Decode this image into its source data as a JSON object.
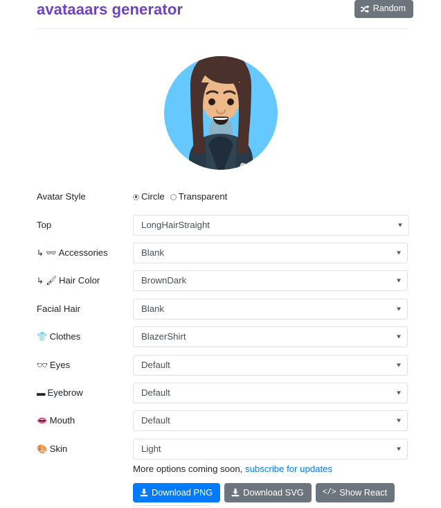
{
  "header": {
    "title": "avataaars generator",
    "random_button": {
      "label": "Random",
      "icon": "shuffle-icon",
      "bg": "#6c757d"
    },
    "title_color": "#6f42c1"
  },
  "avatar": {
    "style": "Circle",
    "background_color": "#65C9FF",
    "skin_color": "#EDB98A",
    "hair_color": "#4A312C",
    "clothes_color": "#25557C",
    "clothes_shade": "#3C4F5C"
  },
  "form": {
    "rows": [
      {
        "label": "Avatar Style",
        "icon": null,
        "nested": false,
        "control": "radio",
        "options": [
          {
            "label": "Circle",
            "checked": true
          },
          {
            "label": "Transparent",
            "checked": false
          }
        ]
      },
      {
        "label": "Top",
        "icon": null,
        "nested": false,
        "control": "select",
        "value": "LongHairStraight"
      },
      {
        "label": "Accessories",
        "icon": "glasses-icon",
        "nested": true,
        "control": "select",
        "value": "Blank"
      },
      {
        "label": "Hair Color",
        "icon": "paintbrush-icon",
        "nested": true,
        "control": "select",
        "value": "BrownDark"
      },
      {
        "label": "Facial Hair",
        "icon": null,
        "nested": false,
        "control": "select",
        "value": "Blank"
      },
      {
        "label": "Clothes",
        "icon": "shirt-icon",
        "nested": false,
        "control": "select",
        "value": "BlazerShirt"
      },
      {
        "label": "Eyes",
        "icon": "eyes-icon",
        "nested": false,
        "control": "select",
        "value": "Default"
      },
      {
        "label": "Eyebrow",
        "icon": "eyebrow-icon",
        "nested": false,
        "control": "select",
        "value": "Default"
      },
      {
        "label": "Mouth",
        "icon": "mouth-icon",
        "nested": false,
        "control": "select",
        "value": "Default"
      },
      {
        "label": "Skin",
        "icon": "palette-icon",
        "nested": false,
        "control": "select",
        "value": "Light"
      }
    ],
    "nest_arrow": "↳"
  },
  "footer": {
    "note_text": "More options coming soon, ",
    "note_link": "subscribe for updates",
    "buttons": [
      {
        "label": "Download PNG",
        "icon": "download-icon",
        "style": "primary",
        "bg": "#007bff"
      },
      {
        "label": "Download SVG",
        "icon": "download-icon",
        "style": "secondary",
        "bg": "#6c757d"
      },
      {
        "label": "Show React",
        "icon": "code-icon",
        "style": "secondary",
        "bg": "#6c757d"
      }
    ]
  }
}
